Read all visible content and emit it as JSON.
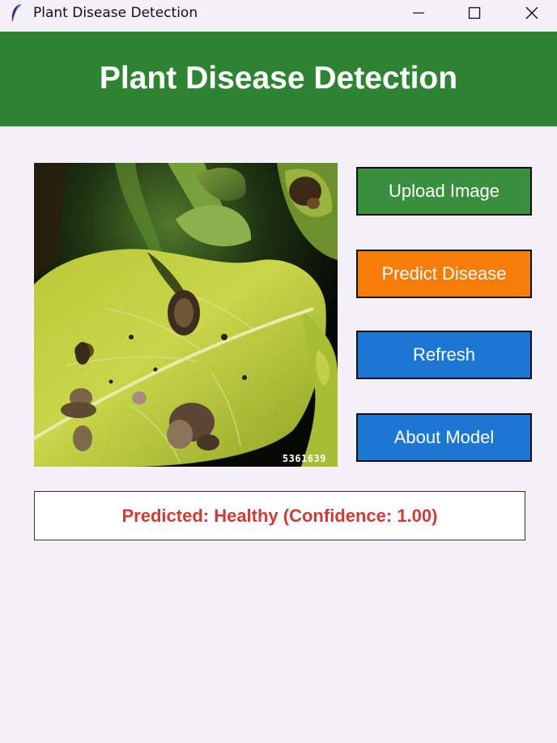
{
  "window": {
    "title": "Plant Disease Detection",
    "icon": "feather-icon",
    "controls": [
      "minimize-icon",
      "maximize-icon",
      "close-icon"
    ]
  },
  "header": {
    "title": "Plant Disease Detection",
    "background": "#2f8434"
  },
  "image": {
    "overlay_number": "5361639"
  },
  "buttons": {
    "upload": {
      "label": "Upload Image",
      "color": "#3a8f3e"
    },
    "predict": {
      "label": "Predict Disease",
      "color": "#f77d0b"
    },
    "refresh": {
      "label": "Refresh",
      "color": "#1d76d4"
    },
    "about": {
      "label": "About Model",
      "color": "#1d76d4"
    }
  },
  "result": {
    "text": "Predicted: Healthy (Confidence: 1.00)",
    "color": "#d23b35"
  }
}
